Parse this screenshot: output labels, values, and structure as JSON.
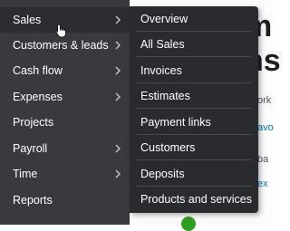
{
  "nav": {
    "items": [
      {
        "label": "Sales",
        "has_submenu": true,
        "active": true
      },
      {
        "label": "Customers & leads",
        "has_submenu": true
      },
      {
        "label": "Cash flow",
        "has_submenu": true
      },
      {
        "label": "Expenses",
        "has_submenu": true
      },
      {
        "label": "Projects",
        "has_submenu": false
      },
      {
        "label": "Payroll",
        "has_submenu": true
      },
      {
        "label": "Time",
        "has_submenu": true
      },
      {
        "label": "Reports",
        "has_submenu": false
      }
    ]
  },
  "flyout": {
    "items": [
      {
        "label": "Overview"
      },
      {
        "label": "All Sales"
      },
      {
        "label": "Invoices"
      },
      {
        "label": "Estimates"
      },
      {
        "label": "Payment links"
      },
      {
        "label": "Customers"
      },
      {
        "label": "Deposits"
      },
      {
        "label": "Products and services"
      }
    ]
  },
  "background": {
    "heading_1": "m",
    "heading_2": "ns",
    "snippet_1": "ork",
    "snippet_2": "avo",
    "snippet_3": "ba",
    "snippet_4": "ex"
  },
  "colors": {
    "nav_bg": "#393a3d",
    "nav_active_bg": "#2c2d30",
    "flyout_bg": "#2a2b2e",
    "text": "#ffffff",
    "link": "#0077c5",
    "accent_green": "#2ca01c"
  }
}
